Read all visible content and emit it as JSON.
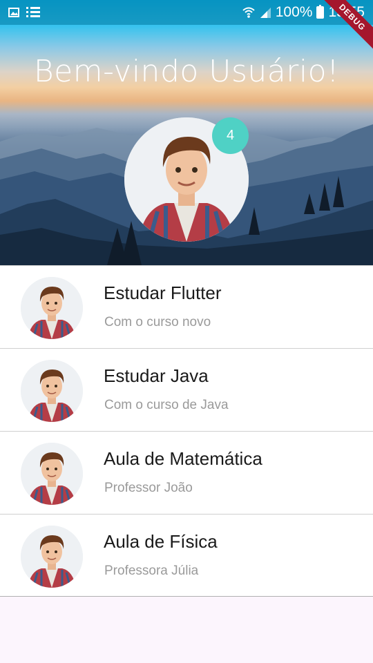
{
  "status_bar": {
    "battery": "100%",
    "time": "15:55",
    "icons": [
      "image-icon",
      "list-icon",
      "wifi-icon",
      "signal-icon",
      "battery-icon"
    ]
  },
  "debug_banner": "DEBUG",
  "header": {
    "welcome": "Bem-vindo Usuário!",
    "badge_count": "4"
  },
  "colors": {
    "badge": "#4fd1c5",
    "background": "#fcf5fd",
    "title": "#1a1a1a",
    "subtitle": "#9a9a9a"
  },
  "items": [
    {
      "title": "Estudar Flutter",
      "subtitle": "Com o curso novo"
    },
    {
      "title": "Estudar Java",
      "subtitle": "Com o curso de Java"
    },
    {
      "title": "Aula de Matemática",
      "subtitle": "Professor João"
    },
    {
      "title": "Aula de Física",
      "subtitle": "Professora Júlia"
    }
  ]
}
